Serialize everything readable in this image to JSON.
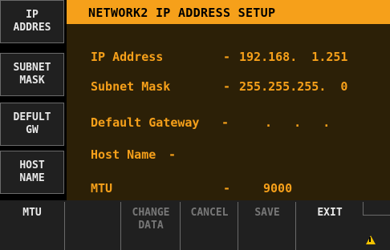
{
  "side_menu": [
    {
      "label_line1": "IP",
      "label_line2": "ADDRES"
    },
    {
      "label_line1": "SUBNET",
      "label_line2": "MASK"
    },
    {
      "label_line1": "DEFULT",
      "label_line2": "GW"
    },
    {
      "label_line1": "HOST",
      "label_line2": "NAME"
    }
  ],
  "title": "NETWORK2 IP ADDRESS SETUP",
  "fields": {
    "ip": {
      "label": "IP Address",
      "sep": "-",
      "value": "192.168.  1.251"
    },
    "mask": {
      "label": "Subnet Mask",
      "sep": "-",
      "value": "255.255.255.  0"
    },
    "gateway": {
      "label": "Default Gateway",
      "sep": "-",
      "value": ".   .   ."
    },
    "host": {
      "label": "Host Name",
      "sep": "-"
    },
    "mtu": {
      "label": "MTU",
      "sep": "-",
      "value": "9000"
    }
  },
  "bottom_bar": {
    "mtu": "MTU",
    "change_line1": "CHANGE",
    "change_line2": "DATA",
    "cancel": "CANCEL",
    "save": "SAVE",
    "exit": "EXIT"
  },
  "colors": {
    "accent": "#f6a01a",
    "panel_bg": "#2c2007"
  },
  "icons": [
    "warning-icon"
  ]
}
